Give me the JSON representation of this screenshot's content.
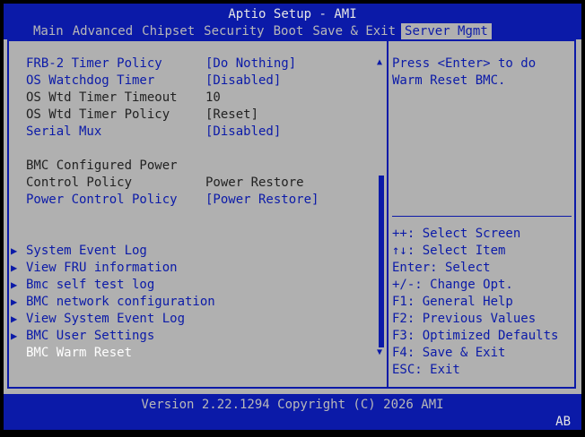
{
  "title": "Aptio Setup - AMI",
  "tabs": [
    "Main",
    "Advanced",
    "Chipset",
    "Security",
    "Boot",
    "Save & Exit",
    "Server Mgmt"
  ],
  "active_tab": "Server Mgmt",
  "settings": [
    {
      "label": "FRB-2 Timer Policy",
      "value": "[Do Nothing]"
    },
    {
      "label": "OS Watchdog Timer",
      "value": "[Disabled]"
    },
    {
      "label": "OS Wtd Timer Timeout",
      "value": "10"
    },
    {
      "label": "OS Wtd Timer Policy",
      "value": "[Reset]"
    },
    {
      "label": "Serial Mux",
      "value": "[Disabled]"
    },
    {
      "label": "BMC Configured Power",
      "value": ""
    },
    {
      "label": "Control Policy",
      "value": "Power Restore"
    },
    {
      "label": "Power Control Policy",
      "value": "[Power Restore]"
    }
  ],
  "submenus": [
    "System Event Log",
    "View FRU information",
    "Bmc self test log",
    "BMC network configuration",
    "View System Event Log",
    "BMC User Settings"
  ],
  "selected_item": "BMC Warm Reset",
  "help_text": [
    "Press <Enter> to do",
    "Warm Reset BMC."
  ],
  "keys": [
    "++: Select Screen",
    "↑↓: Select Item",
    "Enter: Select",
    "+/-: Change Opt.",
    "F1: General Help",
    "F2: Previous Values",
    "F3: Optimized Defaults",
    "F4: Save & Exit",
    "ESC: Exit"
  ],
  "version": "Version 2.22.1294 Copyright (C) 2026 AMI",
  "corner_code": "AB",
  "colors": {
    "blue": "#0b1aa8",
    "gray": "#b0b0b0",
    "white": "#ffffff"
  }
}
